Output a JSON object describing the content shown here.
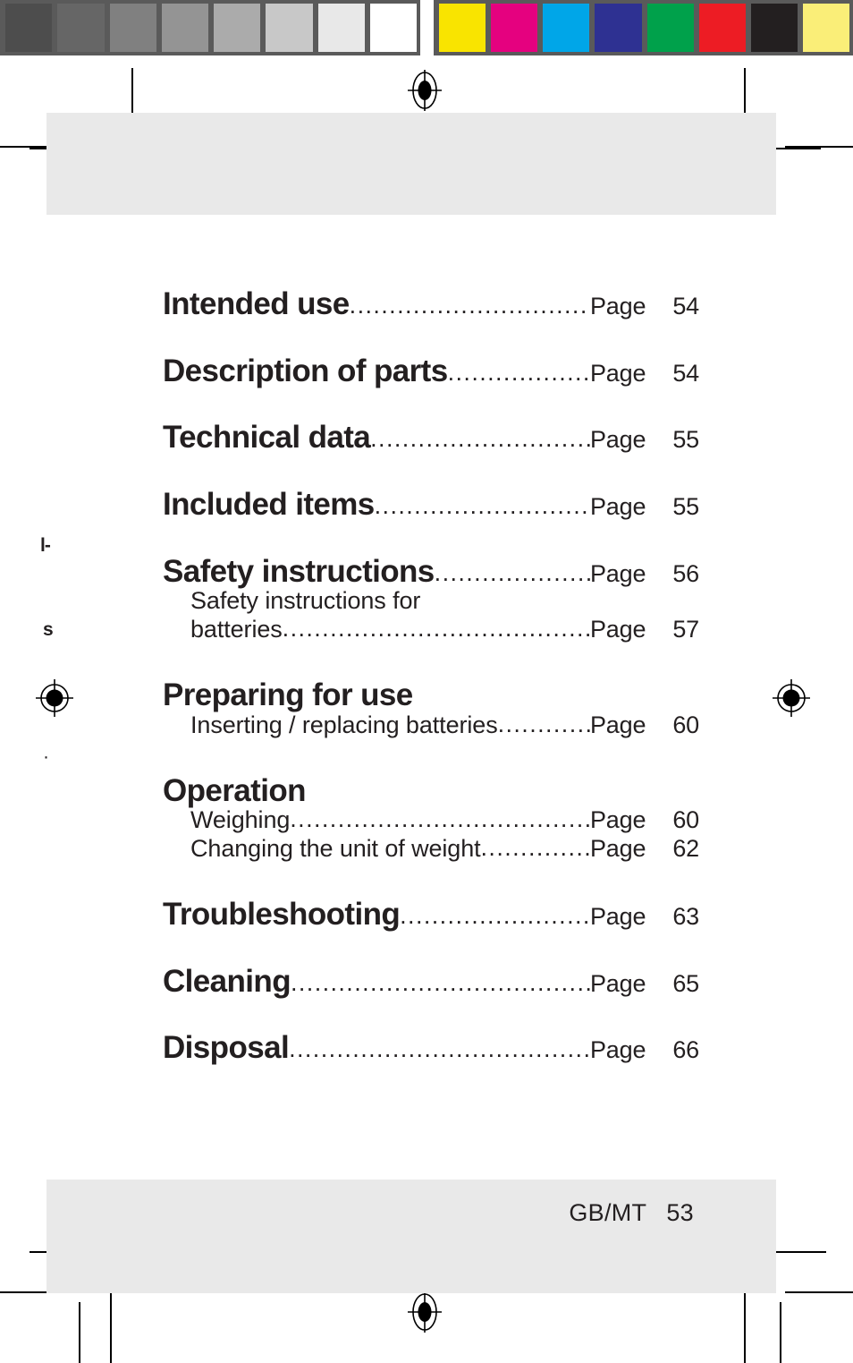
{
  "document": {
    "language_marker": "GB/MT",
    "page_number": "53"
  },
  "calibration": {
    "grayscale_label": "grayscale-calibration-bar",
    "color_label": "color-calibration-bar",
    "grayscale_swatches": [
      "#4d4d4d",
      "#666666",
      "#808080",
      "#949494",
      "#ababab",
      "#c8c8c8",
      "#e8e8e8",
      "#ffffff"
    ],
    "color_swatches": [
      "#f9e400",
      "#e5017f",
      "#00a6e8",
      "#2e3192",
      "#00a14b",
      "#ed1c24",
      "#231f20",
      "#faee78"
    ],
    "bar_background": "#5a5a5a"
  },
  "toc": {
    "page_word": "Page",
    "leader_dots": "......................................................................................",
    "groups": [
      {
        "main": {
          "label": "Intended use",
          "page_word": "Page",
          "page": "54"
        },
        "subs": []
      },
      {
        "main": {
          "label": "Description of parts",
          "page_word": "Page",
          "page": "54"
        },
        "subs": []
      },
      {
        "main": {
          "label": "Technical data",
          "page_word": "Page",
          "page": "55"
        },
        "subs": []
      },
      {
        "main": {
          "label": "Included items",
          "page_word": "Page",
          "page": "55"
        },
        "subs": []
      },
      {
        "main": {
          "label": "Safety instructions",
          "page_word": "Page",
          "page": "56"
        },
        "subs": [
          {
            "label_line1": "Safety instructions for",
            "label": "batteries",
            "page_word": "Page",
            "page": "57"
          }
        ]
      },
      {
        "main": {
          "label": "Preparing for use",
          "page_word": "",
          "page": ""
        },
        "subs": [
          {
            "label": "Inserting / replacing batteries",
            "page_word": "Page",
            "page": "60"
          }
        ]
      },
      {
        "main": {
          "label": "Operation",
          "page_word": "",
          "page": ""
        },
        "subs": [
          {
            "label": "Weighing",
            "page_word": "Page",
            "page": "60"
          },
          {
            "label": "Changing the unit of weight",
            "page_word": "Page",
            "page": "62"
          }
        ]
      },
      {
        "main": {
          "label": "Troubleshooting",
          "page_word": "Page",
          "page": "63"
        },
        "subs": []
      },
      {
        "main": {
          "label": "Cleaning",
          "page_word": "Page",
          "page": "65"
        },
        "subs": []
      },
      {
        "main": {
          "label": "Disposal",
          "page_word": "Page",
          "page": "66"
        },
        "subs": []
      }
    ]
  },
  "bleed_fragments": {
    "fragment_1": "l-",
    "fragment_2": "s",
    "fragment_3": "·"
  },
  "colors": {
    "page_band": "#e9e9e9",
    "text": "#231f20",
    "crop_mark": "#000000",
    "paper": "#ffffff"
  }
}
